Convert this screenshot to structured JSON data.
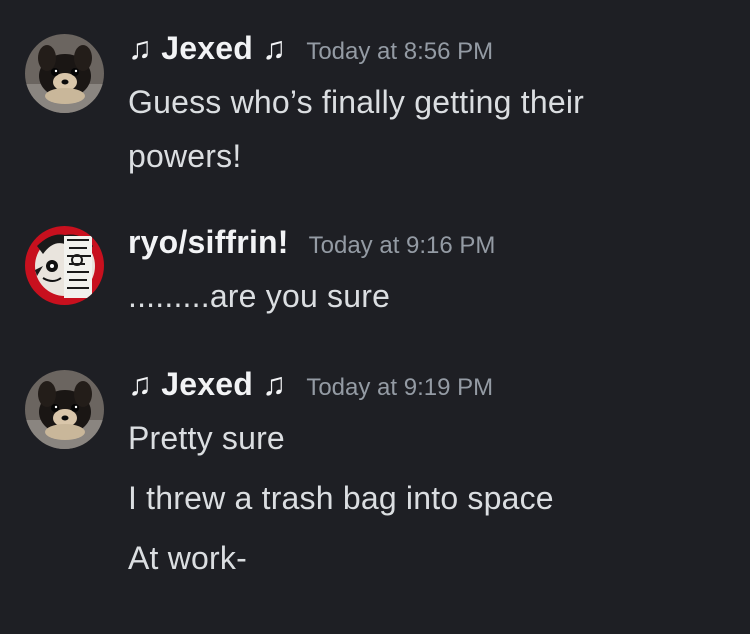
{
  "messages": [
    {
      "author": "♫ Jexed ♫",
      "timestamp": "Today at 8:56 PM",
      "avatar_icon": "dog-avatar-icon",
      "lines": [
        "Guess who’s finally getting their",
        "powers!"
      ]
    },
    {
      "author": "ryo/siffrin!",
      "timestamp": "Today at 9:16 PM",
      "avatar_icon": "anime-character-avatar-icon",
      "lines": [
        ".........are you sure"
      ]
    },
    {
      "author": "♫ Jexed ♫",
      "timestamp": "Today at 9:19 PM",
      "avatar_icon": "dog-avatar-icon",
      "lines": [
        "Pretty sure",
        "I threw a trash bag into space",
        "At work-"
      ]
    }
  ],
  "colors": {
    "background": "#1e1f24",
    "author": "#f2f3f5",
    "timestamp": "#949ba4",
    "text": "#dbdee1",
    "accent_red": "#c8101e"
  }
}
